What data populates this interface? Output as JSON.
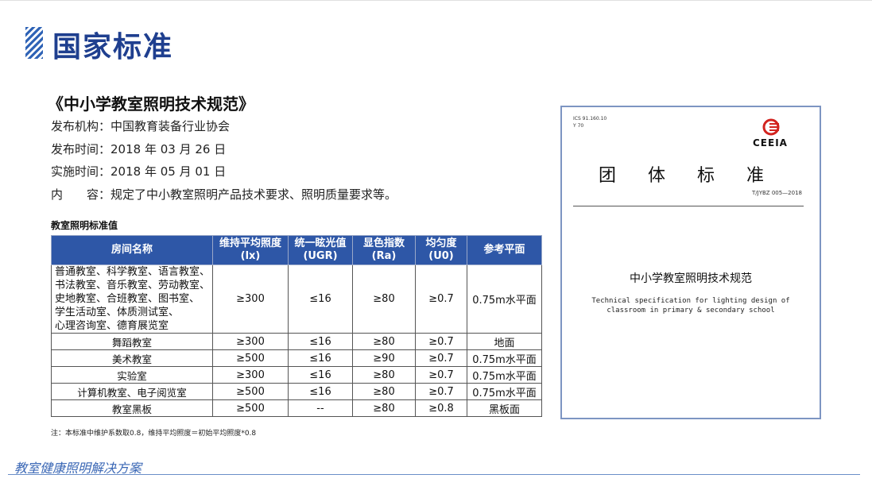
{
  "header": {
    "title": "国家标准"
  },
  "doc": {
    "title": "《中小学教室照明技术规范》",
    "info": [
      {
        "key": "发布机构：",
        "value": "中国教育装备行业协会"
      },
      {
        "key": "发布时间：",
        "value": "2018 年 03 月 26 日"
      },
      {
        "key": "实施时间：",
        "value": "2018 年 05 月 01 日"
      },
      {
        "key": "内　　容：",
        "value": "规定了中小教室照明产品技术要求、照明质量要求等。"
      }
    ]
  },
  "table": {
    "caption": "教室照明标准值",
    "headers": [
      "房间名称",
      "维持平均照度\n(lx)",
      "统一眩光值\n(UGR)",
      "显色指数\n(Ra)",
      "均匀度\n(U0)",
      "参考平面"
    ],
    "rows": [
      [
        "普通教室、科学教室、语言教室、\n书法教室、音乐教室、劳动教室、\n史地教室、合班教室、图书室、\n学生活动室、体质测试室、\n心理咨询室、德育展览室",
        "≥300",
        "≤16",
        "≥80",
        "≥0.7",
        "0.75m水平面"
      ],
      [
        "舞蹈教室",
        "≥300",
        "≤16",
        "≥80",
        "≥0.7",
        "地面"
      ],
      [
        "美术教室",
        "≥500",
        "≤16",
        "≥90",
        "≥0.7",
        "0.75m水平面"
      ],
      [
        "实验室",
        "≥300",
        "≤16",
        "≥80",
        "≥0.7",
        "0.75m水平面"
      ],
      [
        "计算机教室、电子阅览室",
        "≥500",
        "≤16",
        "≥80",
        "≥0.7",
        "0.75m水平面"
      ],
      [
        "教室黑板",
        "≥500",
        "--",
        "≥80",
        "≥0.8",
        "黑板面"
      ]
    ],
    "note": "注：本标准中维护系数取0.8，维持平均照度＝初始平均照度*0.8"
  },
  "cover": {
    "ics": "ICS  91.160.10",
    "y": "Y  70",
    "logo_text": "CEEIA",
    "heading": "团体标准",
    "code": "T/JYBZ  005—2018",
    "name": "中小学教室照明技术规范",
    "en_line1": "Technical specification for lighting design of",
    "en_line2": "classroom in primary & secondary school"
  },
  "footer": {
    "text": "教室健康照明解决方案"
  },
  "colors": {
    "accent": "#1f3f8f",
    "table_header": "#2e57a7",
    "footer": "#3a67b5"
  }
}
